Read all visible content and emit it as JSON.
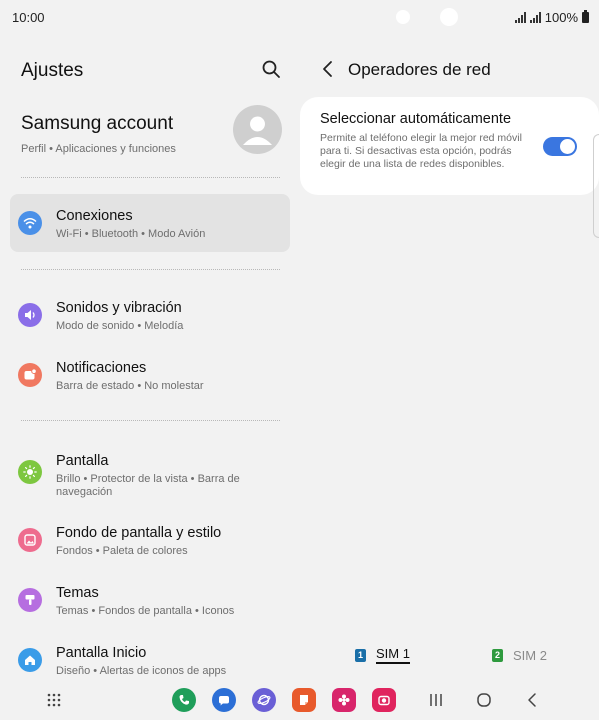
{
  "status": {
    "time": "10:00",
    "battery": "100%"
  },
  "left": {
    "title": "Ajustes",
    "account": {
      "name": "Samsung account",
      "subtitle": "Perfil  •  Aplicaciones y funciones"
    },
    "items": [
      {
        "title": "Conexiones",
        "subtitle": "Wi-Fi  •  Bluetooth  •  Modo Avión",
        "icon": "wifi-icon",
        "color": "#4a90e8"
      },
      {
        "title": "Sonidos y vibración",
        "subtitle": "Modo de sonido  •  Melodía",
        "icon": "speaker-icon",
        "color": "#8a6ee8"
      },
      {
        "title": "Notificaciones",
        "subtitle": "Barra de estado  •  No molestar",
        "icon": "notification-icon",
        "color": "#f07860"
      },
      {
        "title": "Pantalla",
        "subtitle": "Brillo  •  Protector de la vista  •  Barra de navegación",
        "icon": "sun-icon",
        "color": "#7dc740"
      },
      {
        "title": "Fondo de pantalla y estilo",
        "subtitle": "Fondos  •  Paleta de colores",
        "icon": "wallpaper-icon",
        "color": "#ee6c8e"
      },
      {
        "title": "Temas",
        "subtitle": "Temas  •  Fondos de pantalla  •  Iconos",
        "icon": "brush-icon",
        "color": "#b66ee0"
      },
      {
        "title": "Pantalla Inicio",
        "subtitle": "Diseño  •  Alertas de iconos de apps",
        "icon": "home-icon",
        "color": "#3a9ce8"
      }
    ]
  },
  "right": {
    "title": "Operadores de red",
    "option": {
      "title": "Seleccionar automáticamente",
      "description": "Permite al teléfono elegir la mejor red móvil para ti. Si desactivas esta opción, podrás elegir de una lista de redes disponibles.",
      "enabled": true
    },
    "sims": [
      {
        "badge": "1",
        "label": "SIM 1",
        "color": "#1a6fa8"
      },
      {
        "badge": "2",
        "label": "SIM 2",
        "color": "#2e9a3e"
      }
    ]
  },
  "dock": [
    {
      "icon": "phone-app-icon",
      "color": "#1f9e5a"
    },
    {
      "icon": "messages-app-icon",
      "color": "#2c6fd6"
    },
    {
      "icon": "internet-app-icon",
      "color": "#6a5fd6"
    },
    {
      "icon": "notes-app-icon",
      "color": "#e85a2c"
    },
    {
      "icon": "gallery-app-icon",
      "color": "#d8256b"
    },
    {
      "icon": "camera-app-icon",
      "color": "#e0245e"
    }
  ]
}
